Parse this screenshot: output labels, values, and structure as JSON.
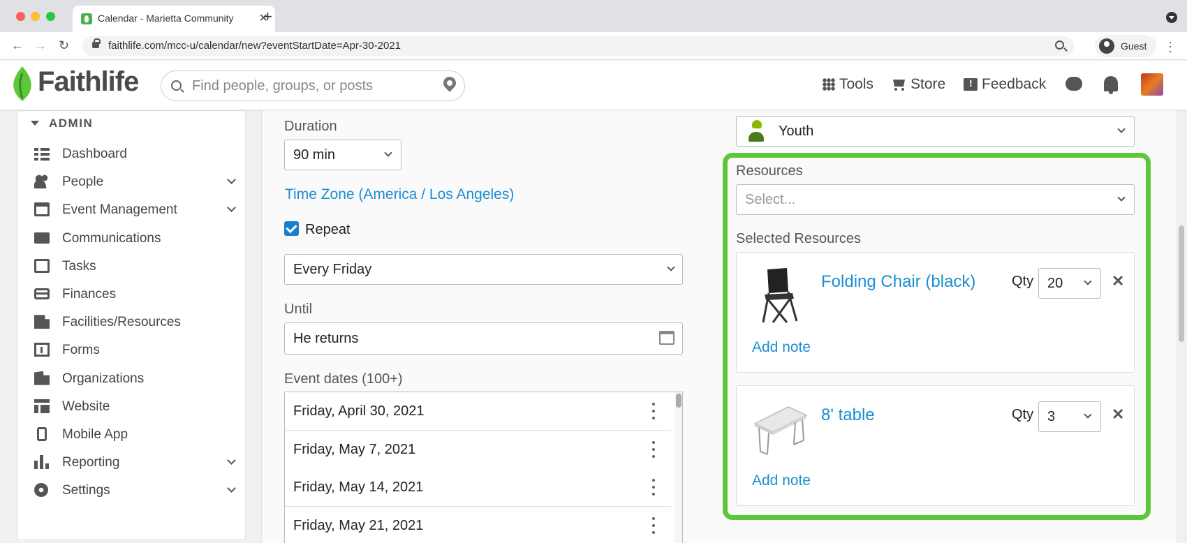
{
  "browser": {
    "tab_title": "Calendar - Marietta Community",
    "url": "faithlife.com/mcc-u/calendar/new?eventStartDate=Apr-30-2021",
    "profile_label": "Guest"
  },
  "header": {
    "logo_text": "Faithlife",
    "search_placeholder": "Find people, groups, or posts",
    "tools_label": "Tools",
    "store_label": "Store",
    "feedback_label": "Feedback"
  },
  "sidebar": {
    "section_label": "ADMIN",
    "items": [
      {
        "label": "Dashboard",
        "icon": "dashboard-icon",
        "expandable": false
      },
      {
        "label": "People",
        "icon": "people-icon",
        "expandable": true
      },
      {
        "label": "Event Management",
        "icon": "calendar-icon",
        "expandable": true
      },
      {
        "label": "Communications",
        "icon": "mail-icon",
        "expandable": false
      },
      {
        "label": "Tasks",
        "icon": "tasks-icon",
        "expandable": false
      },
      {
        "label": "Finances",
        "icon": "credit-card-icon",
        "expandable": false
      },
      {
        "label": "Facilities/Resources",
        "icon": "building-icon",
        "expandable": false
      },
      {
        "label": "Forms",
        "icon": "forms-icon",
        "expandable": false
      },
      {
        "label": "Organizations",
        "icon": "organization-icon",
        "expandable": false
      },
      {
        "label": "Website",
        "icon": "website-icon",
        "expandable": false
      },
      {
        "label": "Mobile App",
        "icon": "mobile-icon",
        "expandable": false
      },
      {
        "label": "Reporting",
        "icon": "bar-chart-icon",
        "expandable": true
      },
      {
        "label": "Settings",
        "icon": "gear-icon",
        "expandable": true
      }
    ]
  },
  "form": {
    "duration_label": "Duration",
    "duration_value": "90 min",
    "timezone_link": "Time Zone (America / Los Angeles)",
    "repeat_label": "Repeat",
    "repeat_checked": true,
    "repeat_value": "Every Friday",
    "until_label": "Until",
    "until_value": "He returns",
    "event_dates_label": "Event dates (100+)",
    "event_dates": [
      "Friday, April 30, 2021",
      "Friday, May 7, 2021",
      "Friday, May 14, 2021",
      "Friday, May 21, 2021"
    ],
    "type_value": "Youth",
    "resources_label": "Resources",
    "resources_placeholder": "Select...",
    "selected_resources_label": "Selected Resources",
    "selected_resources": [
      {
        "name": "Folding Chair (black)",
        "qty_label": "Qty",
        "qty": "20",
        "add_note": "Add note",
        "image": "folding-chair-icon"
      },
      {
        "name": "8' table",
        "qty_label": "Qty",
        "qty": "3",
        "add_note": "Add note",
        "image": "folding-table-icon"
      }
    ]
  },
  "colors": {
    "accent_link": "#1a8ed1",
    "highlight_border": "#5ec639",
    "checkbox": "#1a7fcf"
  }
}
